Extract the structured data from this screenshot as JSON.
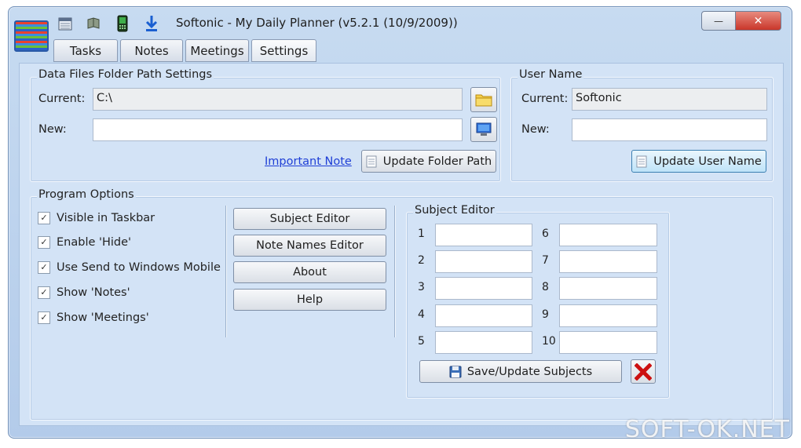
{
  "window": {
    "title": "Softonic - My Daily Planner (v5.2.1 (10/9/2009))",
    "minimize_label": "—",
    "close_label": "✕"
  },
  "toolbar_icons": [
    "calendar-icon",
    "notebook-icon",
    "phone-icon",
    "download-icon"
  ],
  "tabs": [
    {
      "label": "Tasks"
    },
    {
      "label": "Notes"
    },
    {
      "label": "Meetings"
    },
    {
      "label": "Settings"
    }
  ],
  "data_files": {
    "title": "Data Files Folder Path Settings",
    "current_label": "Current:",
    "current_value": "C:\\",
    "new_label": "New:",
    "new_value": "",
    "important_note": "Important Note",
    "update_button": "Update Folder Path"
  },
  "user_name": {
    "title": "User Name",
    "current_label": "Current:",
    "current_value": "Softonic",
    "new_label": "New:",
    "new_value": "",
    "update_button": "Update User Name"
  },
  "program_options": {
    "title": "Program Options",
    "checkboxes": [
      {
        "label": "Visible in Taskbar",
        "checked": true
      },
      {
        "label": "Enable 'Hide'",
        "checked": true
      },
      {
        "label": "Use Send to Windows Mobile",
        "checked": true
      },
      {
        "label": "Show 'Notes'",
        "checked": true
      },
      {
        "label": "Show 'Meetings'",
        "checked": true
      }
    ],
    "buttons": [
      {
        "label": "Subject Editor"
      },
      {
        "label": "Note Names Editor"
      },
      {
        "label": "About"
      },
      {
        "label": "Help"
      }
    ]
  },
  "subject_editor": {
    "title": "Subject Editor",
    "subjects": [
      {
        "number": "1",
        "value": ""
      },
      {
        "number": "2",
        "value": ""
      },
      {
        "number": "3",
        "value": ""
      },
      {
        "number": "4",
        "value": ""
      },
      {
        "number": "5",
        "value": ""
      },
      {
        "number": "6",
        "value": ""
      },
      {
        "number": "7",
        "value": ""
      },
      {
        "number": "8",
        "value": ""
      },
      {
        "number": "9",
        "value": ""
      },
      {
        "number": "10",
        "value": ""
      }
    ],
    "save_button": "Save/Update Subjects"
  },
  "watermark": "SOFT-OK.NET",
  "colors": {
    "window_background": "#c7dbf1",
    "panel_background": "#d3e3f6",
    "link": "#1f3fd6",
    "close_button": "#d9453a",
    "clear_icon": "#cc1111"
  }
}
